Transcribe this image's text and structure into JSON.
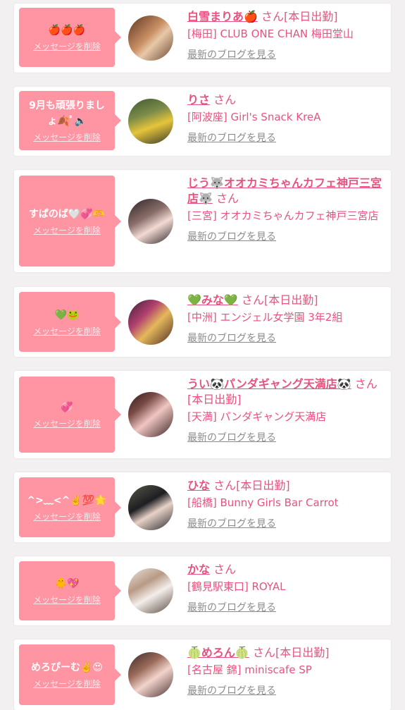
{
  "entries": [
    {
      "message": "🍎🍎🍎",
      "delete_label": "メッセージを削除",
      "name": "白雪まりあ🍎",
      "san": "さん",
      "status": "[本日出勤]",
      "shop": "[梅田] CLUB ONE CHAN 梅田堂山",
      "blog_label": "最新のブログを見る"
    },
    {
      "message": "9月も頑張りましょ🍂ﾟ🔈",
      "delete_label": "メッセージを削除",
      "name": "りさ",
      "san": "さん",
      "status": "",
      "shop": "[阿波座] Girl's Snack KreA",
      "blog_label": "最新のブログを見る"
    },
    {
      "message": "すぱのば🤍💞🫶",
      "delete_label": "メッセージを削除",
      "name": "じう🐺オオカミちゃんカフェ神戸三宮店🐺",
      "san": "さん",
      "status": "",
      "shop": "[三宮] オオカミちゃんカフェ神戸三宮店",
      "blog_label": "最新のブログを見る"
    },
    {
      "message": "💚🐸",
      "delete_label": "メッセージを削除",
      "name": "💚みな💚",
      "san": "さん",
      "status": "[本日出勤]",
      "shop": "[中洲] エンジェル女学園 3年2組",
      "blog_label": "最新のブログを見る"
    },
    {
      "message": "💞",
      "delete_label": "メッセージを削除",
      "name": "うい🐼パンダギャング天満店🐼",
      "san": "さん",
      "status": "[本日出勤]",
      "shop": "[天満] パンダギャング天満店",
      "blog_label": "最新のブログを見る"
    },
    {
      "message": "^>﹏<^✌️💯🌟",
      "delete_label": "メッセージを削除",
      "name": "ひな",
      "san": "さん",
      "status": "[本日出勤]",
      "shop": "[船橋] Bunny Girls Bar Carrot",
      "blog_label": "最新のブログを見る"
    },
    {
      "message": "🐥💖",
      "delete_label": "メッセージを削除",
      "name": "かな",
      "san": "さん",
      "status": "",
      "shop": "[鶴見駅東口] ROYAL",
      "blog_label": "最新のブログを見る"
    },
    {
      "message": "めろぴーむ✌️😍",
      "delete_label": "メッセージを削除",
      "name": "🍈めろん🍈",
      "san": "さん",
      "status": "[本日出勤]",
      "shop": "[名古屋 錦] miniscafe SP",
      "blog_label": "最新のブログを見る"
    }
  ],
  "colors": {
    "accent": "#e6537e",
    "bubble": "#ff94a2",
    "link_gray": "#8c8c8c",
    "background": "#f2f0f0"
  }
}
